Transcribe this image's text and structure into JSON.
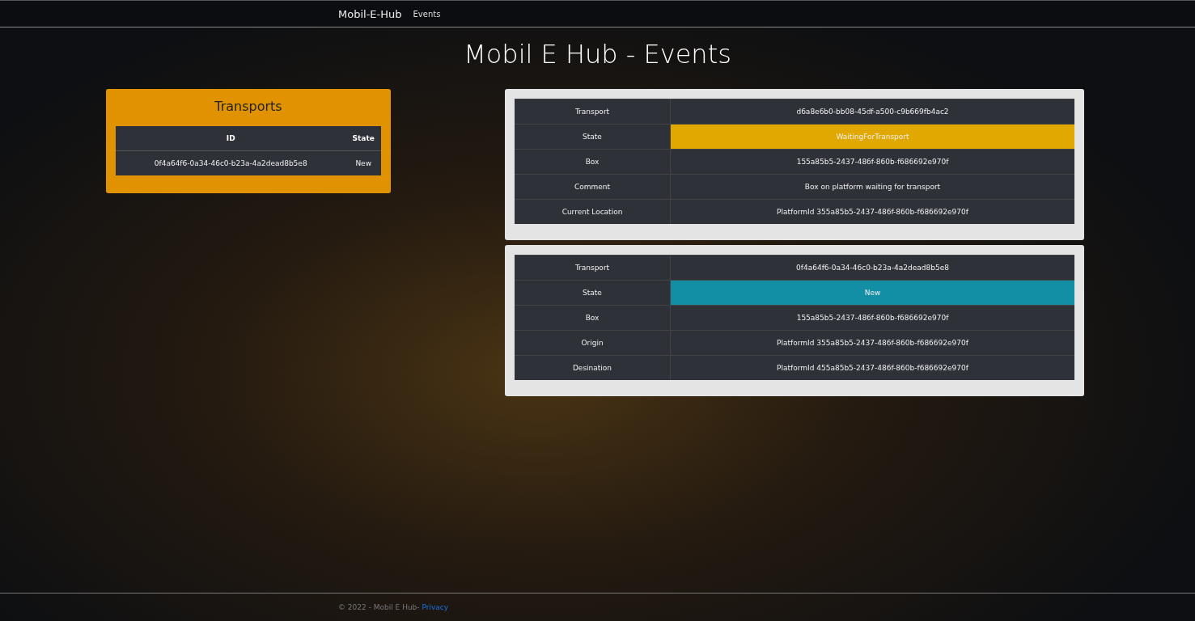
{
  "navbar": {
    "brand": "Mobil-E-Hub",
    "links": [
      "Events"
    ]
  },
  "title": "Mobil E Hub - Events",
  "transports": {
    "title": "Transports",
    "columns": [
      "ID",
      "State"
    ],
    "rows": [
      {
        "id": "0f4a64f6-0a34-46c0-b23a-4a2dead8b5e8",
        "state": "New"
      }
    ]
  },
  "events": [
    {
      "rows": [
        {
          "label": "Transport",
          "value": "d6a8e6b0-bb08-45df-a500-c9b669fb4ac2"
        },
        {
          "label": "State",
          "value": "WaitingForTransport",
          "color": "#e0a800"
        },
        {
          "label": "Box",
          "value": "155a85b5-2437-486f-860b-f686692e970f"
        },
        {
          "label": "Comment",
          "value": "Box on platform waiting for transport"
        },
        {
          "label": "Current Location",
          "value": "PlatformId 355a85b5-2437-486f-860b-f686692e970f"
        }
      ]
    },
    {
      "rows": [
        {
          "label": "Transport",
          "value": "0f4a64f6-0a34-46c0-b23a-4a2dead8b5e8"
        },
        {
          "label": "State",
          "value": "New",
          "color": "#138fa5"
        },
        {
          "label": "Box",
          "value": "155a85b5-2437-486f-860b-f686692e970f"
        },
        {
          "label": "Origin",
          "value": "PlatformId 355a85b5-2437-486f-860b-f686692e970f"
        },
        {
          "label": "Desination",
          "value": "PlatformId 455a85b5-2437-486f-860b-f686692e970f"
        }
      ]
    }
  ],
  "footer": {
    "text": "© 2022 - Mobil E Hub-",
    "link": "Privacy"
  }
}
